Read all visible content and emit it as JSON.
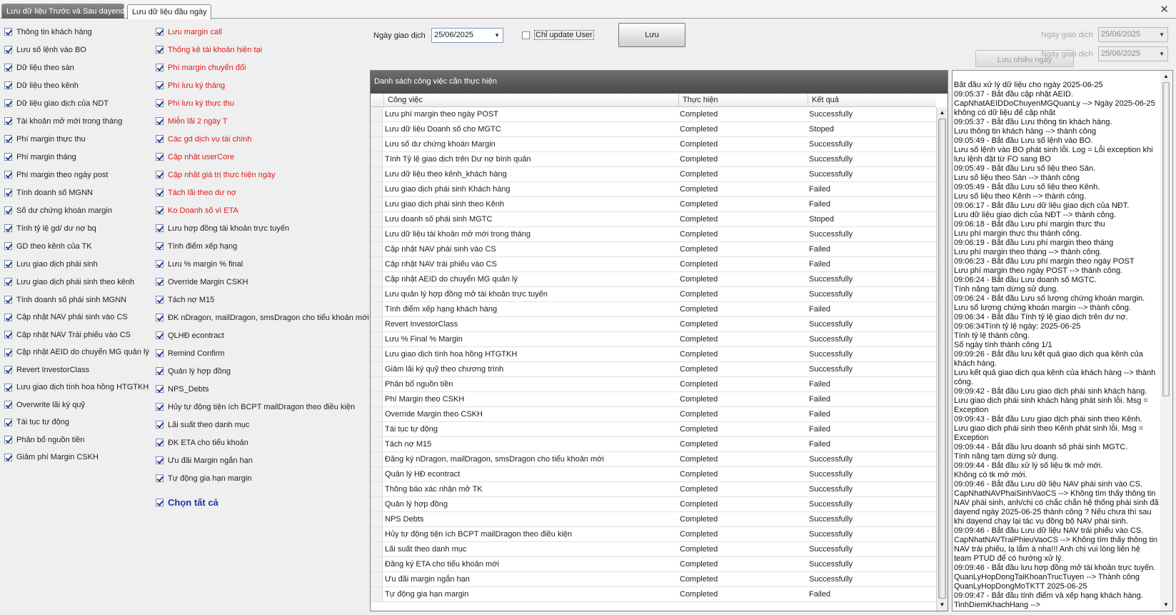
{
  "tabs": [
    "Lưu dữ liệu Trước và Sau dayend",
    "Lưu dữ liệu đầu ngày"
  ],
  "left_col1": [
    {
      "label": "Thông tin khách hàng",
      "red": false
    },
    {
      "label": "Lưu số lệnh vào BO",
      "red": false
    },
    {
      "label": "Dữ liệu theo sàn",
      "red": false
    },
    {
      "label": "Dữ liệu theo kênh",
      "red": false
    },
    {
      "label": "Dữ liệu giao dịch của NDT",
      "red": false
    },
    {
      "label": "Tài khoản mở mới trong tháng",
      "red": false
    },
    {
      "label": "Phí margin thực thu",
      "red": false
    },
    {
      "label": "Phí margin tháng",
      "red": false
    },
    {
      "label": "Phí margin theo ngày post",
      "red": false
    },
    {
      "label": "Tính doanh số MGNN",
      "red": false
    },
    {
      "label": "Số dư chứng khoán margin",
      "red": false
    },
    {
      "label": "Tính tỷ lệ gd/ dư nợ bq",
      "red": false
    },
    {
      "label": "GD theo kênh của TK",
      "red": false
    },
    {
      "label": "Lưu giao dịch phái sinh",
      "red": false
    },
    {
      "label": "Lưu giao dịch phái sinh theo kênh",
      "red": false
    },
    {
      "label": "Tính doanh số phái sinh MGNN",
      "red": false
    },
    {
      "label": "Cập nhật NAV phái sinh vào CS",
      "red": false
    },
    {
      "label": "Cập nhật NAV Trái phiếu vào CS",
      "red": false
    },
    {
      "label": "Cập nhật AEID do chuyển MG quản lý",
      "red": false
    },
    {
      "label": "Revert InvestorClass",
      "red": false
    },
    {
      "label": "Lưu giao dịch tính hoa hồng HTGTKH",
      "red": false
    },
    {
      "label": "Overwrite lãi ký quỹ",
      "red": false
    },
    {
      "label": "Tái tục tự động",
      "red": false
    },
    {
      "label": "Phân bổ nguồn tiền",
      "red": false
    },
    {
      "label": "Giảm phí Margin CSKH",
      "red": false
    }
  ],
  "left_col2": [
    {
      "label": "Lưu margin call",
      "red": true
    },
    {
      "label": "Thống kê tài khoản hiện tại",
      "red": true
    },
    {
      "label": "Phí margin chuyển đổi",
      "red": true
    },
    {
      "label": "Phí lưu ký tháng",
      "red": true
    },
    {
      "label": "Phí lưu ký thực thu",
      "red": true
    },
    {
      "label": "Miễn lãi 2 ngày T",
      "red": true
    },
    {
      "label": "Các gd dịch vụ tài chính",
      "red": true
    },
    {
      "label": "Cập nhật userCore",
      "red": true
    },
    {
      "label": "Cập nhật giá trị thực hiện ngày",
      "red": true
    },
    {
      "label": "Tách lãi theo dư nợ",
      "red": true
    },
    {
      "label": "Ko Doanh số vì ETA",
      "red": true
    },
    {
      "label": "Lưu hợp đồng tài khoản trực tuyến",
      "red": false
    },
    {
      "label": "Tính điểm xếp hạng",
      "red": false
    },
    {
      "label": "Lưu % margin % final",
      "red": false
    },
    {
      "label": "Override Margin CSKH",
      "red": false
    },
    {
      "label": "Tách nợ M15",
      "red": false
    },
    {
      "label": "ĐK nDragon, mailDragon, smsDragon cho tiểu khoản mới",
      "red": false
    },
    {
      "label": "QLHĐ econtract",
      "red": false
    },
    {
      "label": "Remind Confirm",
      "red": false
    },
    {
      "label": "Quản lý hợp đồng",
      "red": false
    },
    {
      "label": "NPS_Debts",
      "red": false
    },
    {
      "label": "Hủy tự động tiện ích BCPT mailDragon theo điều kiện",
      "red": false
    },
    {
      "label": "Lãi suất theo danh mục",
      "red": false
    },
    {
      "label": "ĐK ETA cho tiểu khoản",
      "red": false
    },
    {
      "label": "Ưu đãi Margin ngắn hạn",
      "red": false
    },
    {
      "label": "Tự động gia hạn margin",
      "red": false
    }
  ],
  "select_all": "Chọn tất cả",
  "top": {
    "trade_date_label": "Ngày giao dịch",
    "trade_date": "25/06/2025",
    "only_update_user": "Chỉ update User",
    "save_button": "Lưu",
    "right_date_label_1": "Ngày giao dịch",
    "right_date_1": "25/06/2025",
    "right_date_label_2": "Ngày giao dịch",
    "right_date_2": "25/06/2025",
    "save_many_button": "Lưu nhiều ngày"
  },
  "panel": {
    "title": "Danh sách công việc cần thực hiện",
    "columns": [
      "Công việc",
      "Thực hiện",
      "Kết quả"
    ]
  },
  "rows": [
    [
      "Lưu phí margin theo ngày POST",
      "Completed",
      "Successfully"
    ],
    [
      "Lưu dữ liệu Doanh số cho MGTC",
      "Completed",
      "Stoped"
    ],
    [
      "Lưu số dư chứng khoán Margin",
      "Completed",
      "Successfully"
    ],
    [
      "Tính Tỷ lệ giao dịch trên Dư nợ bình quân",
      "Completed",
      "Successfully"
    ],
    [
      "Lưu dữ liệu theo kênh_khách hàng",
      "Completed",
      "Successfully"
    ],
    [
      "Lưu giao dịch phái sinh Khách hàng",
      "Completed",
      "Failed"
    ],
    [
      "Lưu giao dịch phái sinh theo Kênh",
      "Completed",
      "Failed"
    ],
    [
      "Lưu doanh số phái sinh MGTC",
      "Completed",
      "Stoped"
    ],
    [
      "Lưu dữ liệu tài khoản mở mới trong tháng",
      "Completed",
      "Successfully"
    ],
    [
      "Cập nhật NAV phái sinh vào CS",
      "Completed",
      "Failed"
    ],
    [
      "Cập nhật NAV trái phiếu vào CS",
      "Completed",
      "Failed"
    ],
    [
      "Cập nhật AEID do chuyển MG quản lý",
      "Completed",
      "Successfully"
    ],
    [
      "Lưu quản lý hợp đồng mở tài khoản trực tuyến",
      "Completed",
      "Successfully"
    ],
    [
      "Tính điểm xếp hạng khách hàng",
      "Completed",
      "Failed"
    ],
    [
      "Revert InvestorClass",
      "Completed",
      "Successfully"
    ],
    [
      "Lưu % Final % Margin",
      "Completed",
      "Successfully"
    ],
    [
      "Lưu giao dịch tính hoa hồng HTGTKH",
      "Completed",
      "Successfully"
    ],
    [
      "Giảm lãi ký quỹ theo chương trình",
      "Completed",
      "Successfully"
    ],
    [
      "Phân bổ nguồn tiền",
      "Completed",
      "Failed"
    ],
    [
      "Phí Margin theo CSKH",
      "Completed",
      "Failed"
    ],
    [
      "Override Margin theo CSKH",
      "Completed",
      "Failed"
    ],
    [
      "Tái tục tự động",
      "Completed",
      "Failed"
    ],
    [
      "Tách nợ M15",
      "Completed",
      "Failed"
    ],
    [
      "Đăng ký nDragon, mailDragon, smsDragon cho tiểu khoản mới",
      "Completed",
      "Successfully"
    ],
    [
      "Quản lý HĐ econtract",
      "Completed",
      "Successfully"
    ],
    [
      "Thông báo xác nhận mở TK",
      "Completed",
      "Successfully"
    ],
    [
      "Quản lý hợp đồng",
      "Completed",
      "Successfully"
    ],
    [
      "NPS Debts",
      "Completed",
      "Successfully"
    ],
    [
      "Hủy tự động tiện ích BCPT mailDragon theo điều kiện",
      "Completed",
      "Successfully"
    ],
    [
      "Lãi suất theo danh mục",
      "Completed",
      "Successfully"
    ],
    [
      "Đăng ký ETA cho tiểu khoản mới",
      "Completed",
      "Successfully"
    ],
    [
      "Ưu đãi margin ngắn hạn",
      "Completed",
      "Successfully"
    ],
    [
      "Tự động gia hạn margin",
      "Completed",
      "Failed"
    ]
  ],
  "log": "Bắt đầu xử lý dữ liệu cho ngày 2025-06-25\n09:05:37 - Bắt đầu cập nhật AEID.\nCapNhatAEIDDoChuyenMGQuanLy --> Ngày 2025-06-25 không có dữ liệu để cập nhật\n09:05:37 - Bắt đầu Lưu thông tin khách hàng.\nLưu thông tin khách hàng --> thành công\n09:05:49 - Bắt đầu Lưu số lệnh vào BO.\nLưu số lệnh vào BO phát sinh lỗi. Log = Lỗi exception khi lưu lệnh đặt từ FO sang BO\n09:05:49 - Bắt đầu Lưu số liệu theo Sàn.\nLưu số liệu theo Sàn --> thành công\n09:05:49 - Bắt đầu Lưu số liệu theo Kênh.\nLưu số liệu theo Kênh --> thành công.\n09:06:17 - Bắt đầu Lưu dữ liệu giao dịch của NĐT.\nLưu dữ liệu giao dịch của NĐT --> thành công.\n09:06:18 - Bắt đầu Lưu phí margin thực thu\nLưu phí margin thực thu thành công.\n09:06:19 - Bắt đầu Lưu phí margin theo tháng\nLưu phí margin theo tháng --> thành công.\n09:06:23 - Bắt đầu Lưu phí margin theo ngày POST\nLưu phí margin theo ngày POST --> thành công.\n09:06:24 - Bắt đầu Lưu doanh số MGTC.\nTính năng tạm dừng sử dụng.\n09:06:24 - Bắt đầu Lưu số lượng chứng khoán margin.\nLưu số lượng chứng khoán margin --> thành công.\n09:06:34 - Bắt đầu Tính tỷ lệ giao dịch trên dư nợ.\n09:06:34Tính tỷ lệ ngày: 2025-06-25\nTính tỷ lệ thành công.\nSố ngày tính thành công 1/1\n09:09:26 - Bắt đầu lưu kết quả giao dịch qua kênh của khách hàng.\nLưu kết quả giao dịch qua kênh của khách hàng --> thành công.\n09:09:42 - Bắt đầu Lưu giao dịch phái sinh khách hàng.\nLưu giao dịch phái sinh khách hàng phát sinh lỗi. Msg = Exception\n09:09:43 - Bắt đầu Lưu giao dịch phái sinh theo Kênh.\nLưu giao dịch phái sinh theo Kênh phát sinh lỗi. Msg = Exception\n09:09:44 - Bắt đầu lưu doanh số phái sinh MGTC.\nTính năng tạm dừng sử dụng.\n09:09:44 - Bắt đầu xử lý số liệu tk mở mới.\nKhông có tk mở mới.\n09:09:46 - Bắt đầu Lưu dữ liệu NAV phái sinh vào CS.\nCapNhatNAVPhaiSinhVaoCS --> Không tìm thấy thông tin NAV phái sinh, anh/chị có chắc chắn hệ thống phái sinh đã dayend ngày 2025-06-25 thành công ? Nếu chưa thì sau khi dayend chạy lại tác vụ đồng bộ NAV phái sinh.\n09:09:46 - Bắt đầu Lưu dữ liệu NAV trái phiếu vào CS.\nCapNhatNAVTraiPhieuVaoCS --> Không tìm thấy thông tin NAV trái phiếu, lạ lắm à nha!!! Anh chị vui lòng liên hệ team PTUD để có hướng xử lý.\n09:09:46 - Bắt đầu lưu hợp đồng mở tài khoản trực tuyến.\nQuanLyHopDongTaiKhoanTrucTuyen --> Thành công\nQuanLyHopDongMoTKTT 2025-06-25\n09:09:47 - Bắt đầu tính điểm và xếp hạng khách hàng.\nTinhDiemKhachHang -->"
}
